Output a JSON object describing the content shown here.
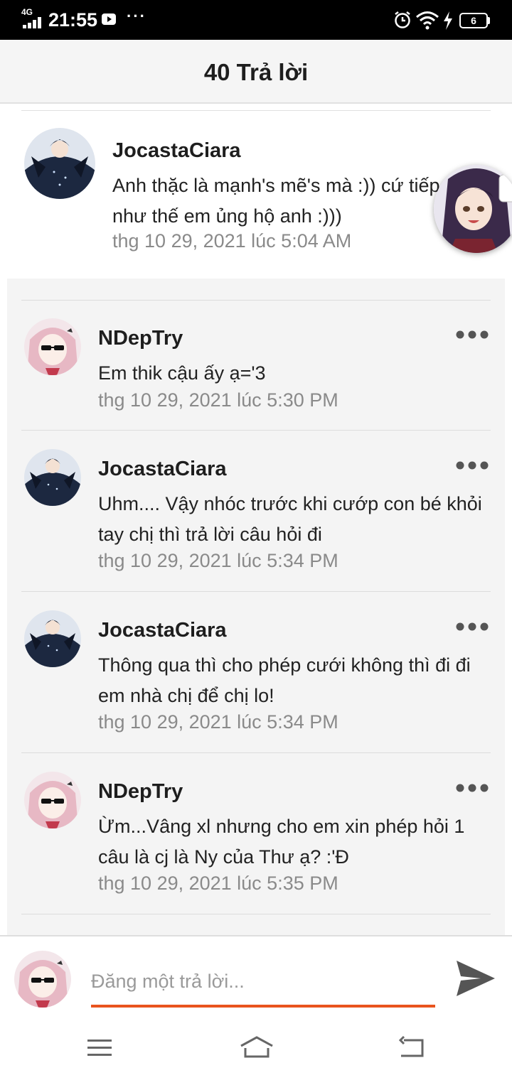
{
  "status_bar": {
    "network": "4G",
    "time": "21:55",
    "more": "···",
    "battery": "6"
  },
  "header": {
    "title": "40 Trả lời"
  },
  "parent_comment": {
    "author": "JocastaCiara",
    "message": "Anh thặc là mạnh's mẽ's mà :)) cứ tiếp như thế em ủng hộ anh :)))",
    "timestamp": "thg 10 29, 2021 lúc 5:04 AM"
  },
  "replies": [
    {
      "author": "NDepTry",
      "message": "Em thik cậu ấy ạ='3",
      "timestamp": "thg 10 29, 2021 lúc 5:30 PM"
    },
    {
      "author": "JocastaCiara",
      "message": "Uhm.... Vậy nhóc trước khi cướp con bé khỏi tay chị thì trả lời câu hỏi đi",
      "timestamp": "thg 10 29, 2021 lúc 5:34 PM"
    },
    {
      "author": "JocastaCiara",
      "message": "Thông qua thì cho phép cưới không thì đi đi em nhà chị để chị lo!",
      "timestamp": "thg 10 29, 2021 lúc 5:34 PM"
    },
    {
      "author": "NDepTry",
      "message": "Ừm...Vâng xl nhưng cho em xin phép hỏi 1 câu là cj là Ny của Thư ạ? :'Đ",
      "timestamp": "thg 10 29, 2021 lúc 5:35 PM"
    }
  ],
  "composer": {
    "placeholder": "Đăng một trả lời..."
  },
  "colors": {
    "accent": "#e9541e",
    "reply_background": "#f4f4f4",
    "muted_text": "#8a8a8a"
  },
  "icons": {
    "send": "send-icon",
    "menu": "menu-icon",
    "home": "home-icon",
    "back": "back-icon",
    "more": "more-options-icon"
  }
}
